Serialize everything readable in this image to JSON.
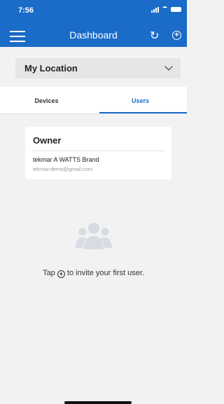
{
  "status_bar": {
    "time": "7:56"
  },
  "header": {
    "title": "Dashboard"
  },
  "location": {
    "selected": "My Location"
  },
  "tabs": [
    {
      "label": "Devices",
      "active": false
    },
    {
      "label": "Users",
      "active": true
    }
  ],
  "owner_card": {
    "title": "Owner",
    "name": "tekmar A WATTS Brand",
    "email": "tekmar.demo@gmail.com"
  },
  "empty_state": {
    "text_before": "Tap",
    "text_after": "to invite your first user."
  },
  "colors": {
    "accent": "#1a6cc8",
    "background": "#f2f2f2"
  },
  "icons": [
    "menu-icon",
    "refresh-icon",
    "add-circle-icon",
    "chevron-down-icon",
    "users-group-icon"
  ]
}
